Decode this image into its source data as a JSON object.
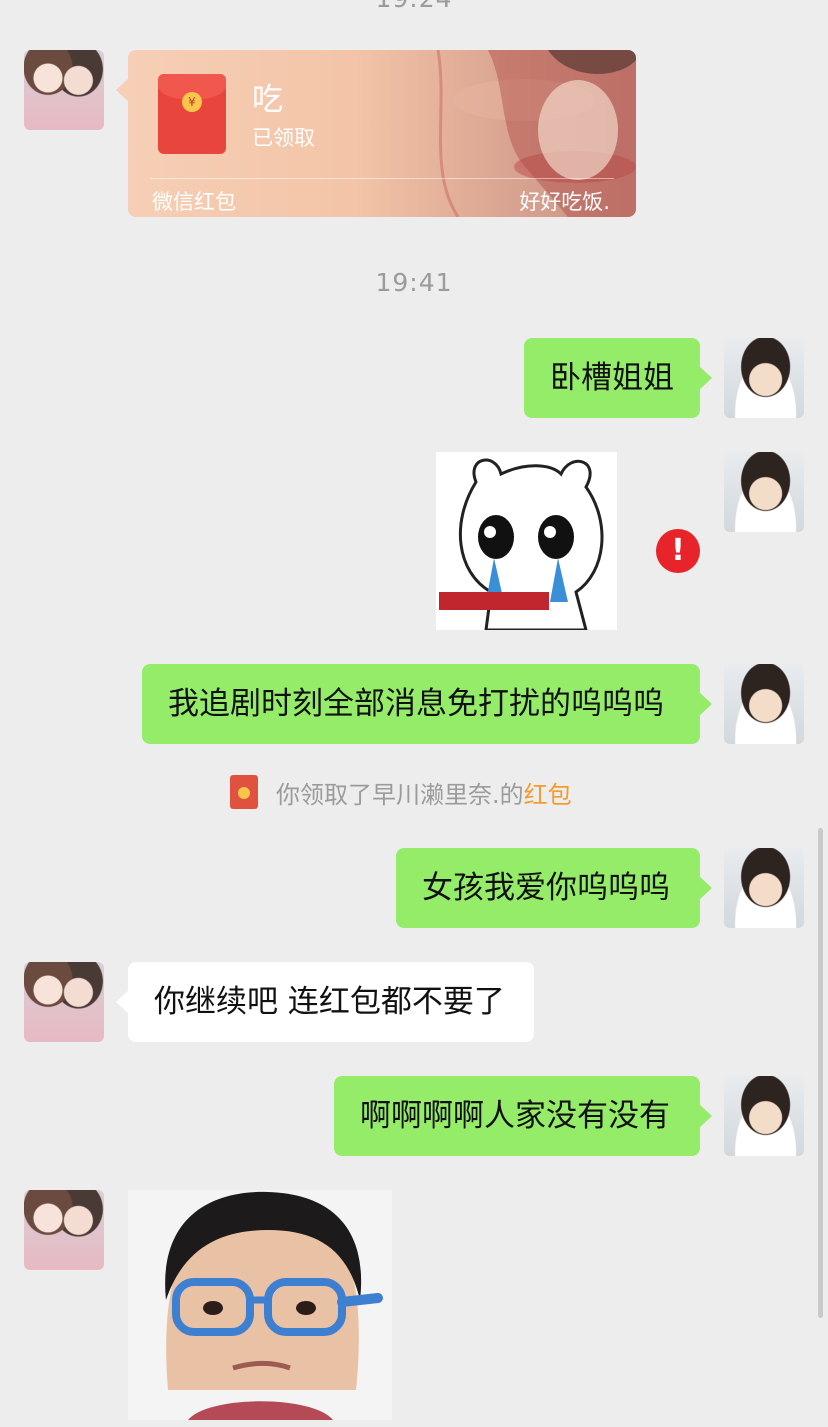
{
  "timestamps": {
    "top_partial": "19:24",
    "mid": "19:41"
  },
  "red_packet": {
    "title": "吃",
    "status": "已领取",
    "label": "微信红包",
    "note": "好好吃饭."
  },
  "messages": {
    "m1": "卧槽姐姐",
    "m2": "我追剧时刻全部消息免打扰的呜呜呜",
    "m3": "女孩我爱你呜呜呜",
    "m4": "你继续吧 连红包都不要了",
    "m5": "啊啊啊啊人家没有没有"
  },
  "notice": {
    "prefix": "你领取了早川濑里奈.的",
    "link": "红包"
  },
  "error_glyph": "!",
  "colors": {
    "bubble_me": "#95ec69",
    "bubble_friend": "#ffffff",
    "background": "#ededed",
    "red_packet_link": "#f39b2d",
    "error": "#e6242a"
  }
}
